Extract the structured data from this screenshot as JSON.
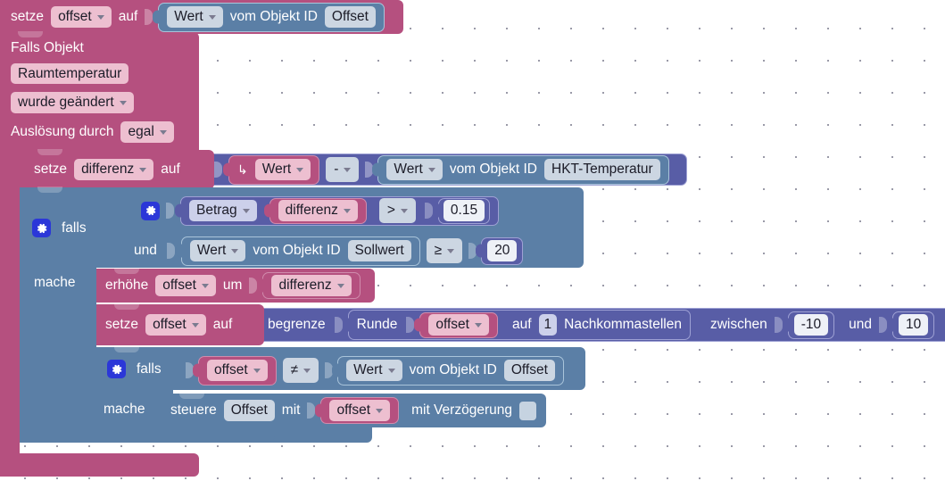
{
  "editor": {
    "type": "blockly-visual-script",
    "language": "de",
    "grid": {
      "visible": true,
      "spacing_px": 36
    },
    "colors": {
      "rose": "#b5507f",
      "steel_blue": "#5b7fa6",
      "indigo": "#585da6",
      "chip_pink": "#edbfd0",
      "chip_grey": "#ccd6e2",
      "chip_lavender": "#ccd0ea",
      "chip_white": "#eef1f7",
      "gear_blue": "#2b37d8",
      "canvas": "#ffffff"
    }
  },
  "blocks": {
    "set_offset_top": {
      "keyword_setze": "setze",
      "variable": "offset",
      "keyword_auf": "auf",
      "value": {
        "dropdown": "Wert",
        "label_object_id": "vom Objekt ID",
        "object_id": "Offset"
      }
    },
    "trigger": {
      "title": "Falls Objekt",
      "object": "Raumtemperatur",
      "condition": "wurde geändert",
      "trigger_label": "Auslösung durch",
      "trigger_value": "egal"
    },
    "set_differenz": {
      "keyword_setze": "setze",
      "variable": "differenz",
      "keyword_auf": "auf",
      "operand_a": {
        "arrow": "↳",
        "dropdown": "Wert"
      },
      "operator": "-",
      "operand_b": {
        "dropdown": "Wert",
        "label_object_id": "vom Objekt ID",
        "object_id": "HKT-Temperatur"
      }
    },
    "if_outer": {
      "keyword_falls": "falls",
      "keyword_und": "und",
      "keyword_mache": "mache",
      "gear_icon": "gear-icon",
      "condition_1": {
        "function": "Betrag",
        "variable": "differenz",
        "operator": ">",
        "compare_value": "0.15"
      },
      "condition_2": {
        "dropdown": "Wert",
        "label_object_id": "vom Objekt ID",
        "object_id": "Sollwert",
        "operator": "≥",
        "compare_value": "20"
      }
    },
    "increase_offset": {
      "keyword_erhoehe": "erhöhe",
      "variable": "offset",
      "keyword_um": "um",
      "amount": "differenz"
    },
    "set_offset_clamp": {
      "keyword_setze": "setze",
      "variable": "offset",
      "keyword_auf": "auf",
      "clamp_label": "begrenze",
      "round_label": "Runde",
      "round_target": "offset",
      "round_auf": "auf",
      "round_digits": "1",
      "round_unit": "Nachkommastellen",
      "between_label": "zwischen",
      "min": "-10",
      "and_label": "und",
      "max": "10"
    },
    "if_inner": {
      "keyword_falls": "falls",
      "keyword_mache": "mache",
      "gear_icon": "gear-icon",
      "condition": {
        "variable": "offset",
        "operator": "≠",
        "dropdown": "Wert",
        "label_object_id": "vom Objekt ID",
        "object_id": "Offset"
      },
      "action": {
        "keyword_steuere": "steuere",
        "target": "Offset",
        "keyword_mit": "mit",
        "value": "offset",
        "delay_label": "mit Verzögerung",
        "delay_value": ""
      }
    }
  }
}
